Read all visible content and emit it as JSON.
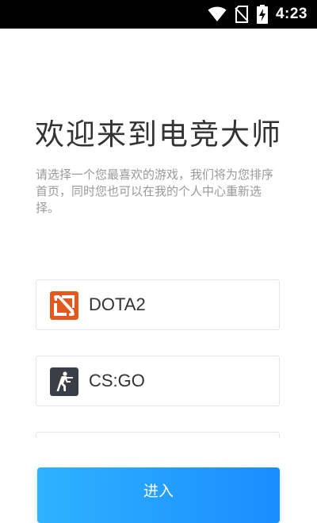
{
  "status_bar": {
    "time": "4:23",
    "icons": [
      "wifi-icon",
      "no-sim-icon",
      "battery-charging-icon"
    ]
  },
  "welcome": {
    "title": "欢迎来到电竞大师",
    "description": "请选择一个您最喜欢的游戏，我们将为您排序首页，同时您也可以在我的个人中心重新选择。"
  },
  "games": [
    {
      "name": "DOTA2",
      "icon": "dota2-logo-icon",
      "color": "#e2581e"
    },
    {
      "name": "CS:GO",
      "icon": "csgo-logo-icon",
      "color": "#3a3e47"
    },
    {
      "name": "",
      "icon": "",
      "color": "#ffffff"
    }
  ],
  "enter_button": {
    "label": "进入",
    "gradient_start": "#2eb2ff",
    "gradient_end": "#1a8dff"
  }
}
